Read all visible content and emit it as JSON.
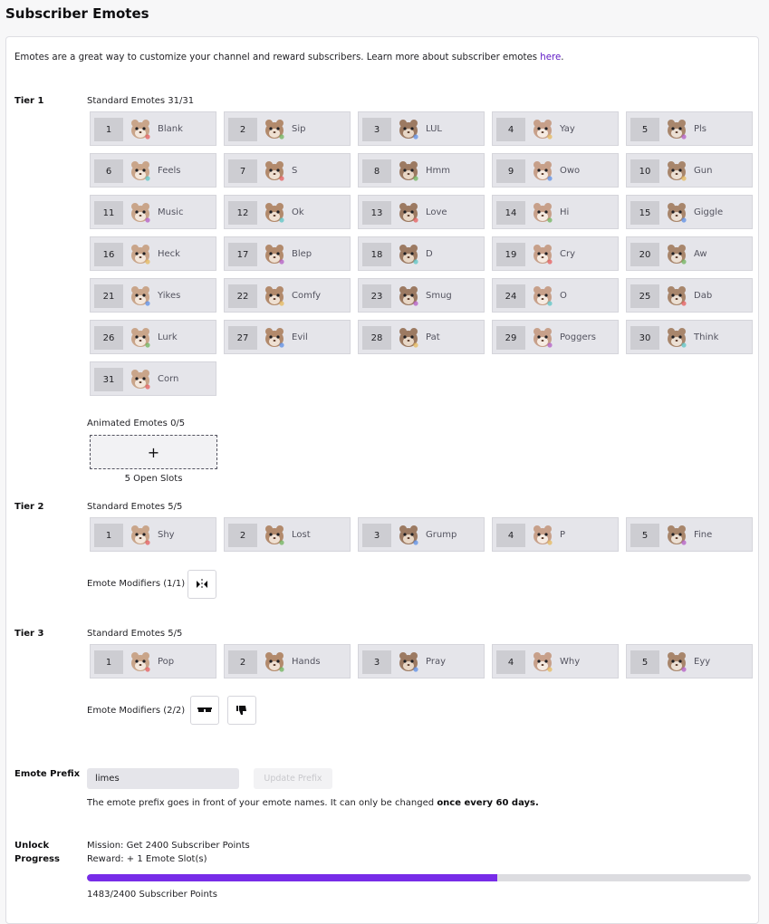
{
  "page": {
    "title": "Subscriber Emotes"
  },
  "intro": {
    "text": "Emotes are a great way to customize your channel and reward subscribers. Learn more about subscriber emotes ",
    "link": "here",
    "end": "."
  },
  "tier1": {
    "label": "Tier 1",
    "standard_label": "Standard Emotes 31/31",
    "emotes": [
      {
        "num": "1",
        "name": "Blank"
      },
      {
        "num": "2",
        "name": "Sip"
      },
      {
        "num": "3",
        "name": "LUL"
      },
      {
        "num": "4",
        "name": "Yay"
      },
      {
        "num": "5",
        "name": "Pls"
      },
      {
        "num": "6",
        "name": "Feels"
      },
      {
        "num": "7",
        "name": "S"
      },
      {
        "num": "8",
        "name": "Hmm"
      },
      {
        "num": "9",
        "name": "Owo"
      },
      {
        "num": "10",
        "name": "Gun"
      },
      {
        "num": "11",
        "name": "Music"
      },
      {
        "num": "12",
        "name": "Ok"
      },
      {
        "num": "13",
        "name": "Love"
      },
      {
        "num": "14",
        "name": "Hi"
      },
      {
        "num": "15",
        "name": "Giggle"
      },
      {
        "num": "16",
        "name": "Heck"
      },
      {
        "num": "17",
        "name": "Blep"
      },
      {
        "num": "18",
        "name": "D"
      },
      {
        "num": "19",
        "name": "Cry"
      },
      {
        "num": "20",
        "name": "Aw"
      },
      {
        "num": "21",
        "name": "Yikes"
      },
      {
        "num": "22",
        "name": "Comfy"
      },
      {
        "num": "23",
        "name": "Smug"
      },
      {
        "num": "24",
        "name": "O"
      },
      {
        "num": "25",
        "name": "Dab"
      },
      {
        "num": "26",
        "name": "Lurk"
      },
      {
        "num": "27",
        "name": "Evil"
      },
      {
        "num": "28",
        "name": "Pat"
      },
      {
        "num": "29",
        "name": "Poggers"
      },
      {
        "num": "30",
        "name": "Think"
      },
      {
        "num": "31",
        "name": "Corn"
      }
    ],
    "animated_label": "Animated Emotes 0/5",
    "add_symbol": "+",
    "open_slots": "5 Open Slots"
  },
  "tier2": {
    "label": "Tier 2",
    "standard_label": "Standard Emotes 5/5",
    "emotes": [
      {
        "num": "1",
        "name": "Shy"
      },
      {
        "num": "2",
        "name": "Lost"
      },
      {
        "num": "3",
        "name": "Grump"
      },
      {
        "num": "4",
        "name": "P"
      },
      {
        "num": "5",
        "name": "Fine"
      }
    ],
    "modifiers_label": "Emote Modifiers (1/1)",
    "modifier_icons": [
      "flip-modifier-icon"
    ]
  },
  "tier3": {
    "label": "Tier 3",
    "standard_label": "Standard Emotes 5/5",
    "emotes": [
      {
        "num": "1",
        "name": "Pop"
      },
      {
        "num": "2",
        "name": "Hands"
      },
      {
        "num": "3",
        "name": "Pray"
      },
      {
        "num": "4",
        "name": "Why"
      },
      {
        "num": "5",
        "name": "Eyy"
      }
    ],
    "modifiers_label": "Emote Modifiers (2/2)",
    "modifier_icons": [
      "sunglasses-modifier-icon",
      "thumbs-down-modifier-icon"
    ]
  },
  "prefix": {
    "label": "Emote Prefix",
    "value": "limes",
    "button": "Update Prefix",
    "note_start": "The emote prefix goes in front of your emote names. It can only be changed ",
    "note_bold": "once every 60 days."
  },
  "unlock": {
    "label_line1": "Unlock",
    "label_line2": "Progress",
    "mission": "Mission: Get 2400 Subscriber Points",
    "reward": "Reward: + 1 Emote Slot(s)",
    "progress_fraction": 0.618,
    "points": "1483/2400 Subscriber Points"
  },
  "colors": {
    "accent": "#772ce8",
    "link": "#5c16c5",
    "slot_bg": "#e5e5ea"
  }
}
